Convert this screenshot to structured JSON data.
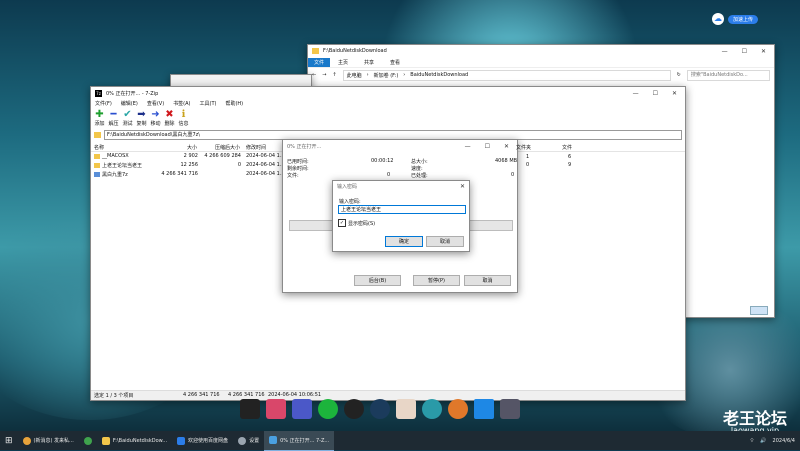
{
  "desktop": {
    "badge_label": "加速上传",
    "watermark_title": "老王论坛",
    "watermark_url": "laowang.vip"
  },
  "explorer": {
    "title": "F:\\BaiduNetdiskDownload",
    "tabs": [
      "文件",
      "主页",
      "共享",
      "查看"
    ],
    "breadcrumb": [
      "此电脑",
      "新加卷 (F:)",
      "BaiduNetdiskDownload"
    ],
    "search_placeholder": "搜索\"BaiduNetdiskDo..."
  },
  "zip": {
    "title": "0% 正在打开... - 7-Zip",
    "menu": [
      "文件(F)",
      "编辑(E)",
      "查看(V)",
      "书签(A)",
      "工具(T)",
      "帮助(H)"
    ],
    "toolbar": [
      "添加",
      "解压",
      "测试",
      "复制",
      "移动",
      "删除",
      "信息"
    ],
    "path": "F:\\BaiduNetdiskDownload\\黑白九重7z\\",
    "columns": [
      "名称",
      "大小",
      "压缩后大小",
      "修改时间"
    ],
    "rows": [
      {
        "name": "__MACOSX",
        "size": "2 902",
        "packed": "4 266 609 284",
        "modified": "2024-06-04 1..."
      },
      {
        "name": "上老王论坛当老王",
        "size": "12 256",
        "packed": "0",
        "modified": "2024-06-04 1..."
      },
      {
        "name": "黑白九重7z",
        "size": "4 266 341 716",
        "packed": "",
        "modified": "2024-06-04 1..."
      }
    ],
    "status": {
      "selection": "选定 1 / 3 个项目",
      "size": "4 266 341 716",
      "packed": "4 266 341 716",
      "date": "2024-06-04 10:06:51"
    }
  },
  "progress": {
    "title": "0% 正在打开...",
    "elapsed_label": "已用时间:",
    "elapsed_value": "00:00:12",
    "remaining_label": "剩余时间:",
    "remaining_value": "",
    "files_label": "文件:",
    "files_value": "0",
    "total_label": "总大小:",
    "total_value": "4068 MB",
    "speed_label": "速度:",
    "speed_value": "",
    "processed_label": "已处理:",
    "processed_value": "0",
    "col_folders": "文件夹",
    "col_files": "文件",
    "row1": {
      "folders": "1",
      "files": "6"
    },
    "row2": {
      "folders": "0",
      "files": "9"
    },
    "btn_background": "后台(B)",
    "btn_pause": "暂停(P)",
    "btn_cancel": "取消"
  },
  "password": {
    "title": "输入密码",
    "label": "输入密码:",
    "value": "上老王论坛当老王",
    "show_label": "显示密码(S)",
    "show_checked": true,
    "ok": "确定",
    "cancel": "取消"
  },
  "taskbar": {
    "items": [
      {
        "label": "(新消息) 发来私...",
        "color": "#e8a33b"
      },
      {
        "label": "",
        "color": "#3fa34d"
      },
      {
        "label": "F:\\BaiduNetdiskDow...",
        "color": "#f3c64a"
      },
      {
        "label": "欢迎使用百度网盘",
        "color": "#2b7de9"
      },
      {
        "label": "设置",
        "color": "#9aa5b0"
      },
      {
        "label": "0% 正在打开... 7-Z...",
        "color": "#4aa0e0"
      }
    ],
    "clock": "2024/6/4"
  }
}
